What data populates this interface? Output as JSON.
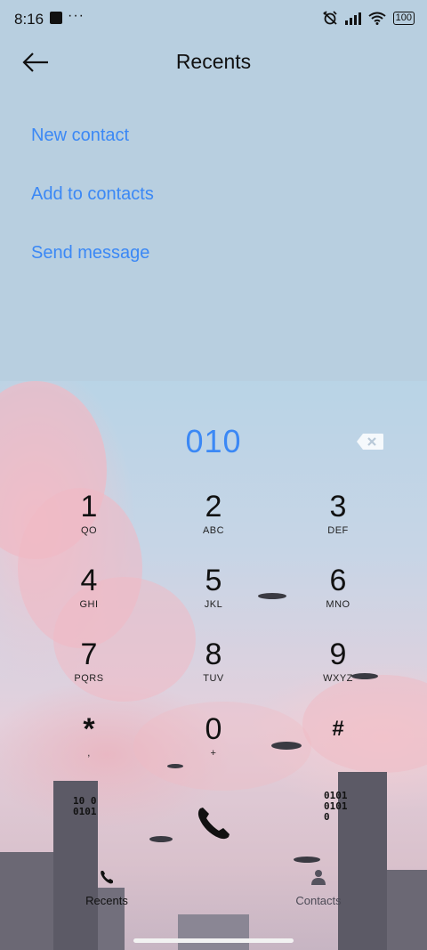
{
  "status_bar": {
    "time": "8:16",
    "more": "···",
    "battery": "100"
  },
  "header": {
    "title": "Recents"
  },
  "actions": [
    {
      "label": "New contact"
    },
    {
      "label": "Add to contacts"
    },
    {
      "label": "Send message"
    }
  ],
  "dialer": {
    "number": "010",
    "keys": [
      {
        "digit": "1",
        "sub": "QO"
      },
      {
        "digit": "2",
        "sub": "ABC"
      },
      {
        "digit": "3",
        "sub": "DEF"
      },
      {
        "digit": "4",
        "sub": "GHI"
      },
      {
        "digit": "5",
        "sub": "JKL"
      },
      {
        "digit": "6",
        "sub": "MNO"
      },
      {
        "digit": "7",
        "sub": "PQRS"
      },
      {
        "digit": "8",
        "sub": "TUV"
      },
      {
        "digit": "9",
        "sub": "WXYZ"
      },
      {
        "digit": "*",
        "sub": ","
      },
      {
        "digit": "0",
        "sub": "+"
      },
      {
        "digit": "#",
        "sub": ""
      }
    ]
  },
  "bottom_nav": {
    "recents": "Recents",
    "contacts": "Contacts"
  },
  "decor": {
    "binary_left": "10 0\n0101",
    "binary_right": "0101\n0101\n0"
  },
  "colors": {
    "accent": "#3b88f5",
    "top_bg": "#b8cfe0"
  }
}
